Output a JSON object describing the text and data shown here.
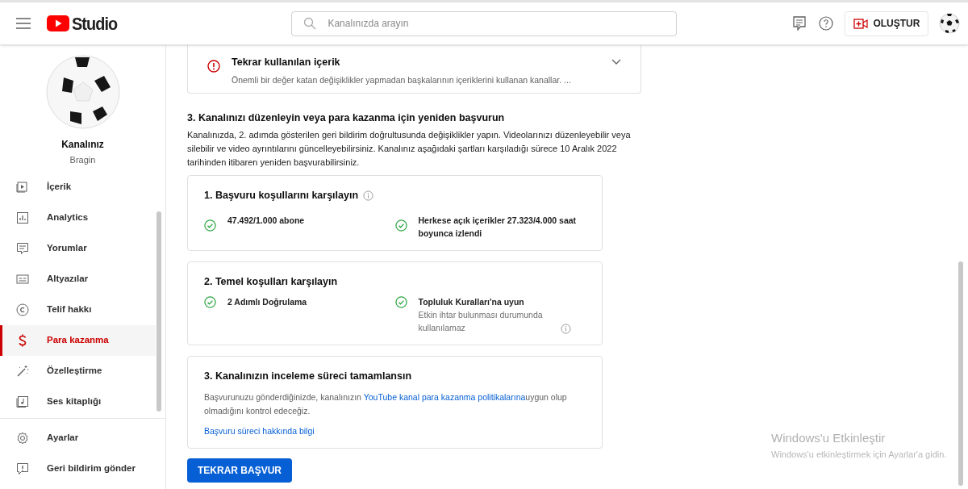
{
  "header": {
    "logo_text": "Studio",
    "search": {
      "placeholder": "Kanalınızda arayın"
    },
    "create_button": "OLUŞTUR"
  },
  "channel": {
    "name": "Kanalınız",
    "handle": "Bragin"
  },
  "sidebar": {
    "items": [
      {
        "label": "İçerik",
        "kind": "content",
        "selected": false
      },
      {
        "label": "Analytics",
        "kind": "analytics",
        "selected": false
      },
      {
        "label": "Yorumlar",
        "kind": "comments",
        "selected": false
      },
      {
        "label": "Altyazılar",
        "kind": "subtitles",
        "selected": false
      },
      {
        "label": "Telif hakkı",
        "kind": "copyright",
        "selected": false
      },
      {
        "label": "Para kazanma",
        "kind": "money",
        "selected": true
      },
      {
        "label": "Özelleştirme",
        "kind": "customize",
        "selected": false
      },
      {
        "label": "Ses kitaplığı",
        "kind": "audio",
        "selected": false
      }
    ],
    "footer_items": [
      {
        "label": "Ayarlar",
        "kind": "settings",
        "selected": false
      },
      {
        "label": "Geri bildirim gönder",
        "kind": "feedback",
        "selected": false
      }
    ]
  },
  "issue_card": {
    "title": "Tekrar kullanılan içerik",
    "description": "Önemli bir değer katan değişiklikler yapmadan başkalarının içeriklerini kullanan kanallar. ...",
    "expanded": false
  },
  "section": {
    "title": "3. Kanalınızı düzenleyin veya para kazanma için yeniden başvurun",
    "description": "Kanalınızda, 2. adımda gösterilen geri bildirim doğrultusunda değişiklikler yapın. Videolarınızı düzenleyebilir veya silebilir ve video ayrıntılarını güncelleyebilirsiniz. Kanalınız aşağıdaki şartları karşıladığı sürece 10 Aralık 2022 tarihinden itibaren yeniden başvurabilirsiniz."
  },
  "requirement_cards": [
    {
      "title": "1. Başvuru koşullarını karşılayın",
      "info": true,
      "items": [
        {
          "text": "47.492/1.000 abone",
          "met": true
        },
        {
          "text": "Herkese açık içerikler 27.323/4.000 saat boyunca izlendi",
          "met": true
        }
      ]
    },
    {
      "title": "2. Temel koşulları karşılayın",
      "info": false,
      "items": [
        {
          "text": "2 Adımlı Doğrulama",
          "met": true
        },
        {
          "text": "Topluluk Kuralları'na uyun",
          "note": "Etkin ihtar bulunması durumunda kullanılamaz",
          "met": true
        }
      ]
    }
  ],
  "review_card": {
    "title": "3. Kanalınızın inceleme süreci tamamlansın",
    "text_before": "Başvurunuzu gönderdiğinizde, kanalınızın ",
    "link": "YouTube kanal para kazanma politikalarına",
    "text_after": "uygun olup olmadığını kontrol edeceğiz.",
    "info_link": "Başvuru süreci hakkında bilgi"
  },
  "apply_button": "TEKRAR BAŞVUR",
  "windows_activation": {
    "title": "Windows'u Etkinleştir",
    "subtitle": "Windows'u etkinleştirmek için Ayarlar'a gidin."
  }
}
